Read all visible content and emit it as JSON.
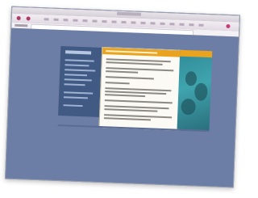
{
  "scene": {
    "description_free": true
  },
  "colors": {
    "desktop": "#6d7ea6",
    "nav": "#415a84",
    "card": "#fbfaf4",
    "accent": "#e9a31f",
    "photo": "#3fa4ae"
  },
  "icons": [
    "back-icon",
    "forward-icon",
    "stop-icon",
    "home-icon",
    "favorite-icon"
  ]
}
